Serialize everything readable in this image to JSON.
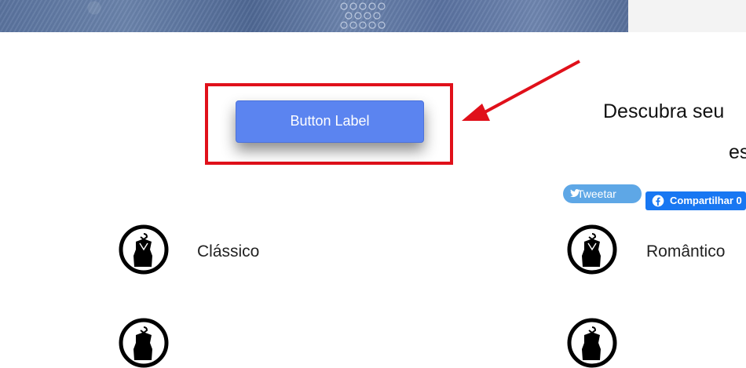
{
  "hero": {
    "image": "denim-jacket-photo"
  },
  "cta": {
    "label": "Button Label"
  },
  "heading": {
    "line1": "Descubra seu",
    "line2": "es"
  },
  "share": {
    "tweet": "Tweetar",
    "facebook": "Compartilhar 0"
  },
  "styles": {
    "items": [
      {
        "label": "Clássico",
        "icon": "dress-hanger-icon"
      },
      {
        "label": "Romântico",
        "icon": "dress-hanger-icon"
      }
    ]
  },
  "colors": {
    "accent": "#5b84f0",
    "annotation": "#e0101a",
    "twitter": "#5ea7e6",
    "facebook": "#1877f2"
  }
}
